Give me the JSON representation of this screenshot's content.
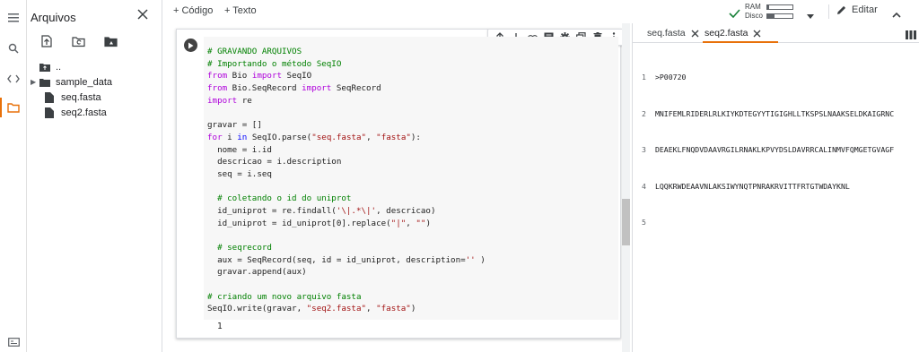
{
  "rail": {
    "icons": [
      "menu-icon",
      "search-icon",
      "code-icon",
      "folder-icon",
      "terminal-icon"
    ]
  },
  "files": {
    "title": "Arquivos",
    "tree": [
      {
        "label": "..",
        "type": "parent"
      },
      {
        "label": "sample_data",
        "type": "folder"
      },
      {
        "label": "seq.fasta",
        "type": "file"
      },
      {
        "label": "seq2.fasta",
        "type": "file"
      }
    ]
  },
  "toolbar": {
    "add_code": "+ Código",
    "add_text": "+ Texto",
    "ram_label": "RAM",
    "disk_label": "Disco",
    "ram_usage": 0.08,
    "disk_usage": 0.3,
    "edit_label": "Editar"
  },
  "cell": {
    "code_lines": [
      [
        [
          "cm",
          "# GRAVANDO ARQUIVOS"
        ]
      ],
      [
        [
          "cm",
          "# Importando o método SeqIO"
        ]
      ],
      [
        [
          "kw",
          "from"
        ],
        [
          "",
          " Bio "
        ],
        [
          "kw",
          "import"
        ],
        [
          "",
          " SeqIO"
        ]
      ],
      [
        [
          "kw",
          "from"
        ],
        [
          "",
          " Bio.SeqRecord "
        ],
        [
          "kw",
          "import"
        ],
        [
          "",
          " SeqRecord"
        ]
      ],
      [
        [
          "kw",
          "import"
        ],
        [
          "",
          " re"
        ]
      ],
      [
        [
          "",
          ""
        ]
      ],
      [
        [
          "",
          "gravar = []"
        ]
      ],
      [
        [
          "kw",
          "for"
        ],
        [
          "",
          " i "
        ],
        [
          "kw2",
          "in"
        ],
        [
          "",
          " SeqIO.parse("
        ],
        [
          "st",
          "\"seq.fasta\""
        ],
        [
          "",
          ", "
        ],
        [
          "st",
          "\"fasta\""
        ],
        [
          "",
          "):"
        ]
      ],
      [
        [
          "",
          "  nome = i.id"
        ]
      ],
      [
        [
          "",
          "  descricao = i.description"
        ]
      ],
      [
        [
          "",
          "  seq = i.seq"
        ]
      ],
      [
        [
          "",
          ""
        ]
      ],
      [
        [
          "cm",
          "  # coletando o id do uniprot"
        ]
      ],
      [
        [
          "",
          "  id_uniprot = re.findall("
        ],
        [
          "st",
          "'\\|.*\\|'"
        ],
        [
          "",
          ", descricao)"
        ]
      ],
      [
        [
          "",
          "  id_uniprot = id_uniprot[0].replace("
        ],
        [
          "st",
          "\"|\""
        ],
        [
          "",
          ", "
        ],
        [
          "st",
          "\"\""
        ],
        [
          "",
          ")"
        ]
      ],
      [
        [
          "",
          ""
        ]
      ],
      [
        [
          "cm",
          "  # seqrecord"
        ]
      ],
      [
        [
          "",
          "  aux = SeqRecord(seq, id = id_uniprot, description="
        ],
        [
          "st",
          "''"
        ],
        [
          "",
          " )"
        ]
      ],
      [
        [
          "",
          "  gravar.append(aux)"
        ]
      ],
      [
        [
          "",
          ""
        ]
      ],
      [
        [
          "cm",
          "# criando um novo arquivo fasta"
        ]
      ],
      [
        [
          "",
          "SeqIO.write(gravar, "
        ],
        [
          "st",
          "\"seq2.fasta\""
        ],
        [
          "",
          ", "
        ],
        [
          "st",
          "\"fasta\""
        ],
        [
          "",
          ")"
        ]
      ]
    ],
    "output": "1"
  },
  "editor": {
    "tabs": [
      {
        "label": "seq.fasta",
        "active": false
      },
      {
        "label": "seq2.fasta",
        "active": true
      }
    ],
    "lines": [
      {
        "n": "1",
        "text": ">P00720"
      },
      {
        "n": "2",
        "text": "MNIFEMLRIDERLRLKIYKDTEGYYTIGIGHLLTKSPSLNAAKSELDKAIGRNC"
      },
      {
        "n": "3",
        "text": "DEAEKLFNQDVDAAVRGILRNAKLKPVYDSLDAVRRCALINMVFQMGETGVAGF"
      },
      {
        "n": "4",
        "text": "LQQKRWDEAAVNLAKSIWYNQTPNRAKRVITTFRTGTWDAYKNL"
      },
      {
        "n": "5",
        "text": ""
      }
    ]
  },
  "colors": {
    "accent": "#e8710a",
    "comment": "#008000",
    "keyword": "#af00db",
    "string": "#a31515"
  }
}
